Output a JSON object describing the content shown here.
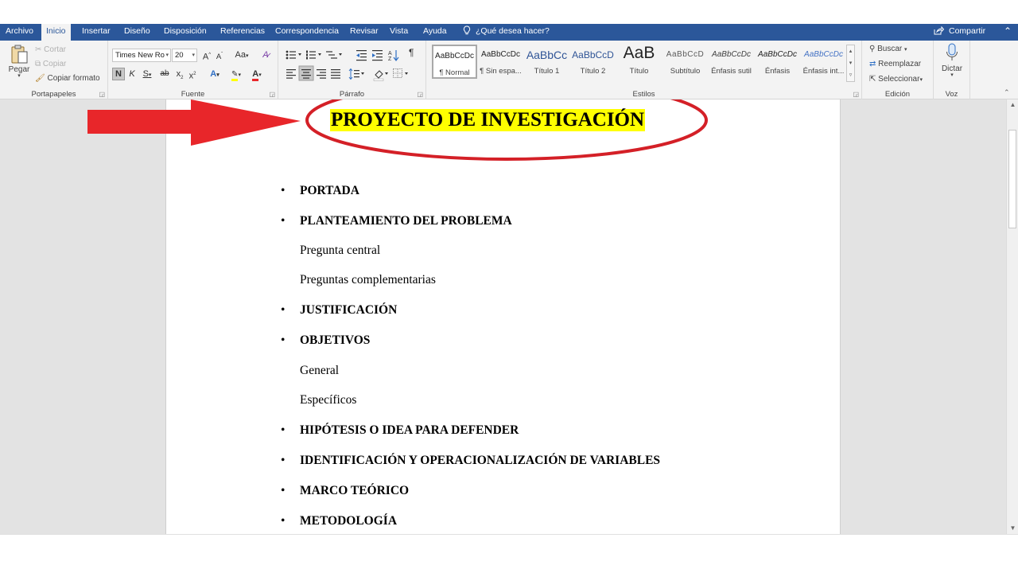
{
  "tabs": [
    {
      "label": "Archivo",
      "active": false
    },
    {
      "label": "Inicio",
      "active": true
    },
    {
      "label": "Insertar",
      "active": false
    },
    {
      "label": "Diseño",
      "active": false
    },
    {
      "label": "Disposición",
      "active": false
    },
    {
      "label": "Referencias",
      "active": false
    },
    {
      "label": "Correspondencia",
      "active": false
    },
    {
      "label": "Revisar",
      "active": false
    },
    {
      "label": "Vista",
      "active": false
    },
    {
      "label": "Ayuda",
      "active": false
    }
  ],
  "tell_me": "¿Qué desea hacer?",
  "share": "Compartir",
  "ribbon": {
    "clipboard": {
      "paste": "Pegar",
      "cut": "Cortar",
      "copy": "Copiar",
      "format_painter": "Copiar formato",
      "label": "Portapapeles"
    },
    "font": {
      "family": "Times New Ro",
      "size": "20",
      "grow": "A",
      "shrink": "A",
      "case": "Aa",
      "bold": "N",
      "italic": "K",
      "underline": "S",
      "strike": "ab",
      "subscript": "x",
      "superscript": "x",
      "text_effects": "A",
      "font_color": "A",
      "label": "Fuente"
    },
    "paragraph": {
      "pilcrow": "¶",
      "label": "Párrafo"
    },
    "styles": {
      "items": [
        {
          "preview": "AaBbCcDc",
          "name": "¶ Normal",
          "selected": true
        },
        {
          "preview": "AaBbCcDc",
          "name": "¶ Sin espa...",
          "selected": false
        },
        {
          "preview": "AaBbCc",
          "name": "Título 1",
          "selected": false
        },
        {
          "preview": "AaBbCcD",
          "name": "Título 2",
          "selected": false
        },
        {
          "preview": "AaB",
          "name": "Título",
          "selected": false
        },
        {
          "preview": "AaBbCcD",
          "name": "Subtítulo",
          "selected": false
        },
        {
          "preview": "AaBbCcDc",
          "name": "Énfasis sutil",
          "selected": false
        },
        {
          "preview": "AaBbCcDc",
          "name": "Énfasis",
          "selected": false
        },
        {
          "preview": "AaBbCcDc",
          "name": "Énfasis int...",
          "selected": false
        }
      ],
      "label": "Estilos"
    },
    "editing": {
      "find": "Buscar",
      "replace": "Reemplazar",
      "select": "Seleccionar",
      "label": "Edición"
    },
    "voice": {
      "dictate": "Dictar",
      "label": "Voz"
    }
  },
  "document": {
    "title": "PROYECTO DE INVESTIGACIÓN",
    "lines": [
      {
        "text": "PORTADA",
        "bullet": true
      },
      {
        "text": "PLANTEAMIENTO DEL PROBLEMA",
        "bullet": true
      },
      {
        "text": "Pregunta central",
        "bullet": false
      },
      {
        "text": "Preguntas complementarias",
        "bullet": false
      },
      {
        "text": "JUSTIFICACIÓN",
        "bullet": true
      },
      {
        "text": "OBJETIVOS",
        "bullet": true
      },
      {
        "text": "General",
        "bullet": false
      },
      {
        "text": "Específicos",
        "bullet": false
      },
      {
        "text": "HIPÓTESIS O IDEA PARA DEFENDER",
        "bullet": true
      },
      {
        "text": "IDENTIFICACIÓN Y OPERACIONALIZACIÓN DE VARIABLES",
        "bullet": true
      },
      {
        "text": "MARCO TEÓRICO",
        "bullet": true
      },
      {
        "text": "METODOLOGÍA",
        "bullet": true
      }
    ],
    "bullet_glyph": "•"
  },
  "annotation": {
    "arrow_color": "#e8262a",
    "ellipse_color": "#d42027"
  },
  "colors": {
    "accent": "#2b579a",
    "highlight": "#ffff00"
  }
}
